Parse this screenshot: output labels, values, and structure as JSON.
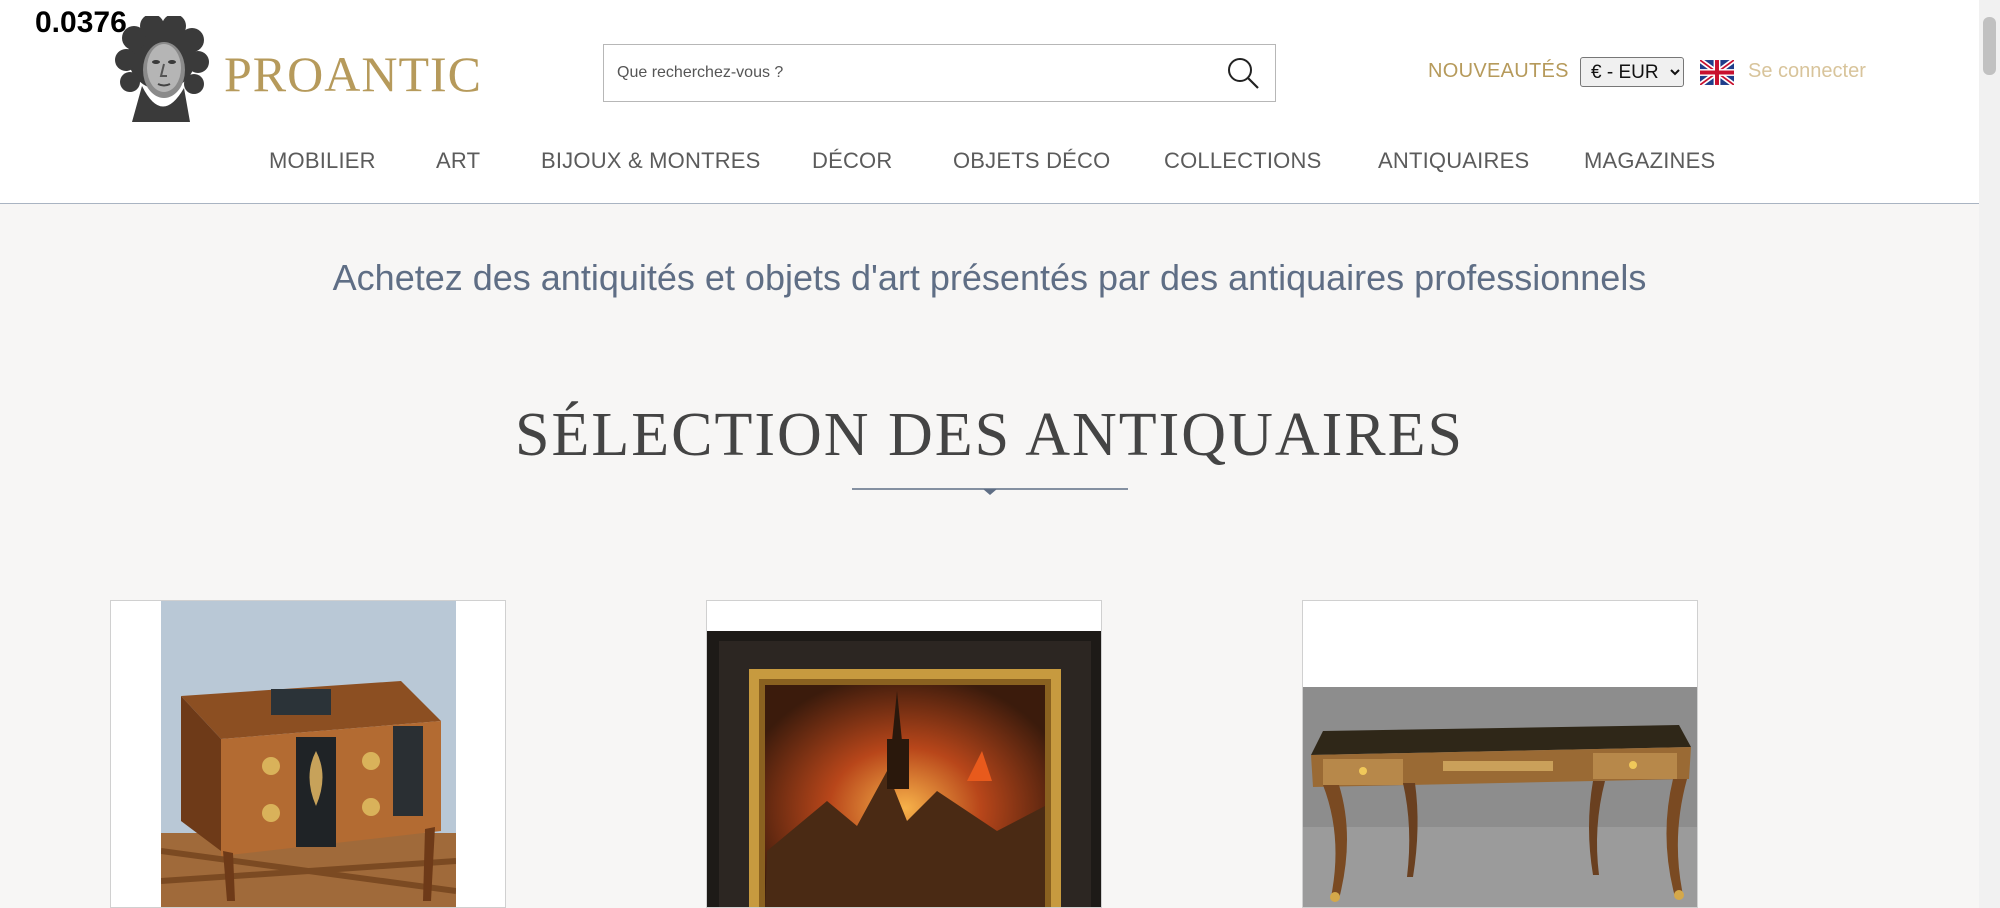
{
  "overlay": {
    "value": "0.0376"
  },
  "header": {
    "brand": "PROANTIC",
    "search_placeholder": "Que recherchez-vous ?",
    "new_label": "NOUVEAUTÉS",
    "currency": {
      "selected": "€ - EUR"
    },
    "login_label": "Se connecter",
    "icons": [
      "bust-logo-icon",
      "search-icon",
      "uk-flag-icon"
    ]
  },
  "nav": {
    "items": [
      {
        "label": "MOBILIER"
      },
      {
        "label": "ART"
      },
      {
        "label": "BIJOUX & MONTRES"
      },
      {
        "label": "DÉCOR"
      },
      {
        "label": "OBJETS DÉCO"
      },
      {
        "label": "COLLECTIONS"
      },
      {
        "label": "ANTIQUAIRES"
      },
      {
        "label": "MAGAZINES"
      }
    ]
  },
  "main": {
    "tagline": "Achetez des antiquités et objets d'art présentés par des antiquaires professionnels",
    "section_title": "SÉLECTION DES ANTIQUAIRES"
  },
  "colors": {
    "brand_gold": "#b69a5b",
    "tagline_blue": "#5f6e85",
    "page_bg": "#f7f6f5"
  }
}
